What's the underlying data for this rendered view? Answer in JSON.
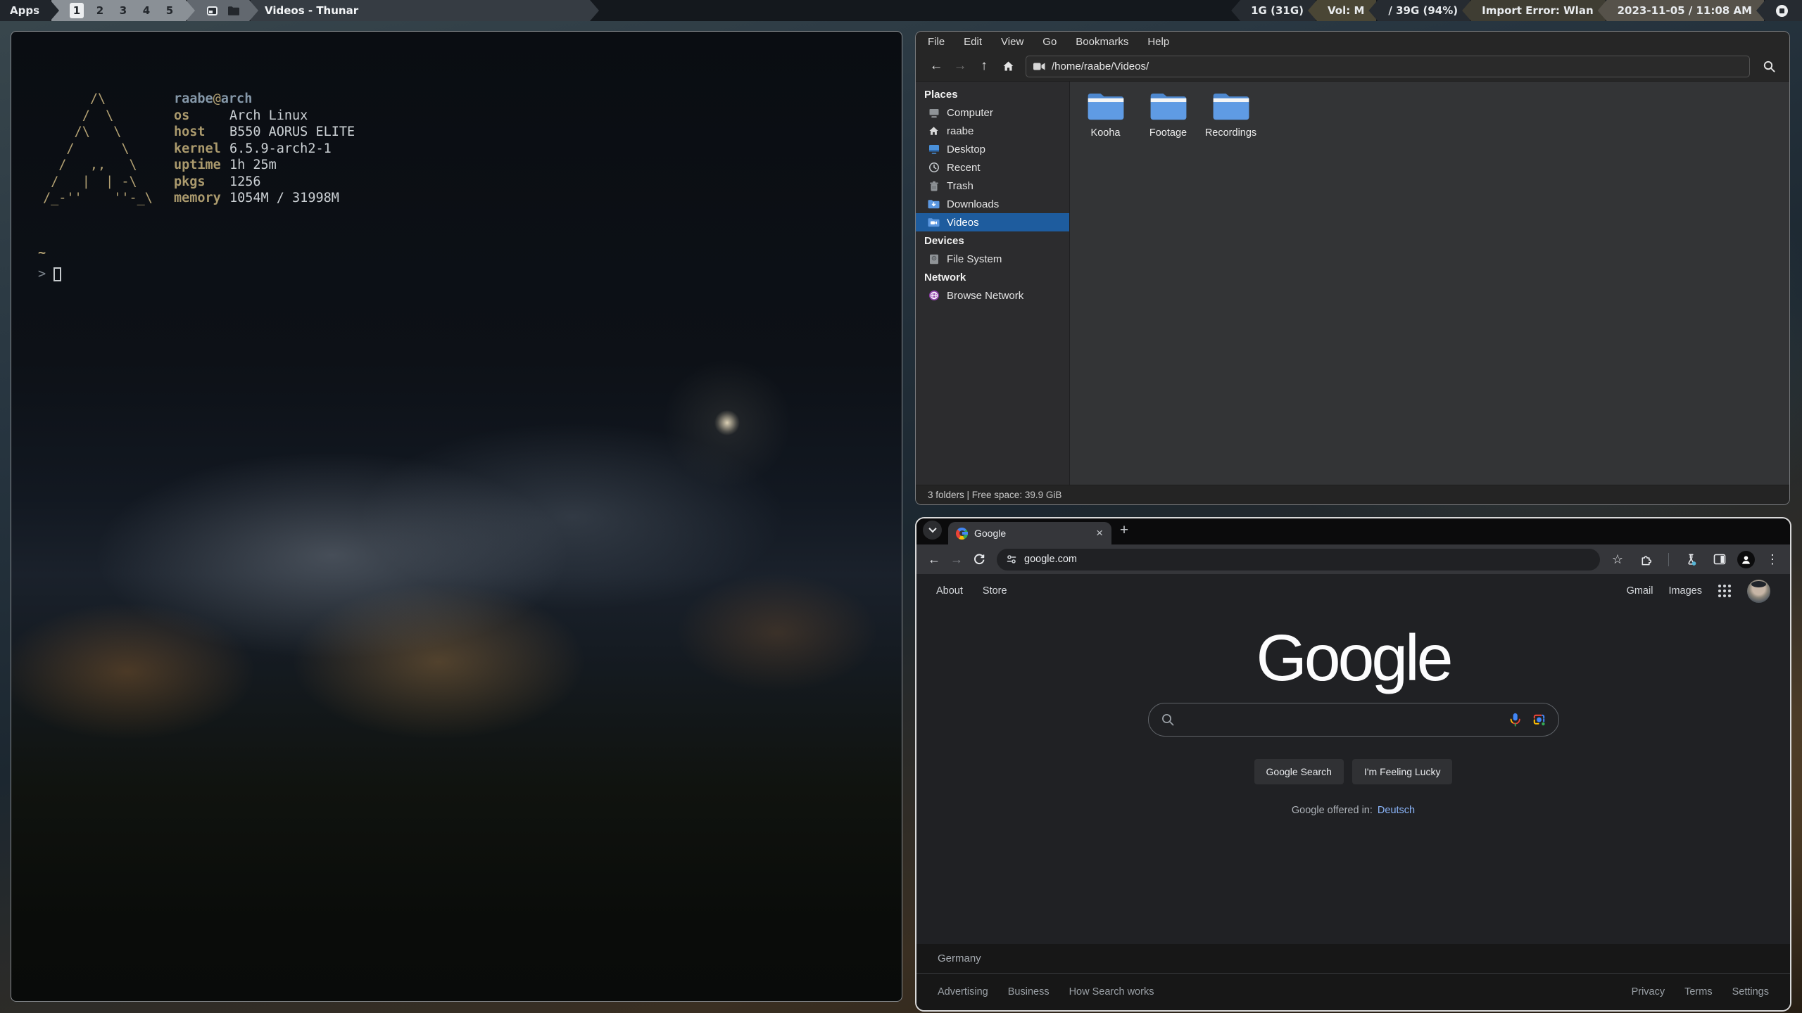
{
  "panel": {
    "apps_label": "Apps",
    "workspaces": [
      "1",
      "2",
      "3",
      "4",
      "5"
    ],
    "active_workspace": "1",
    "window_title": "Videos - Thunar",
    "status": [
      {
        "label": "1G (31G)"
      },
      {
        "label": "Vol: M"
      },
      {
        "label": "/ 39G (94%)"
      },
      {
        "label": "Import Error: Wlan"
      },
      {
        "label": "2023-11-05 / 11:08 AM"
      }
    ]
  },
  "terminal": {
    "ascii_logo": "      /\\\n     /  \\\n    /\\   \\\n   /      \\\n  /   ,,   \\\n /   |  | -\\\n/_-''    ''-_\\",
    "user": "raabe",
    "at": "@",
    "hostname": "arch",
    "info": [
      {
        "label": "os",
        "value": "Arch Linux"
      },
      {
        "label": "host",
        "value": "B550 AORUS ELITE"
      },
      {
        "label": "kernel",
        "value": "6.5.9-arch2-1"
      },
      {
        "label": "uptime",
        "value": "1h 25m"
      },
      {
        "label": "pkgs",
        "value": "1256"
      },
      {
        "label": "memory",
        "value": "1054M / 31998M"
      }
    ],
    "cwd": "~",
    "prompt": ">"
  },
  "thunar": {
    "menus": [
      "File",
      "Edit",
      "View",
      "Go",
      "Bookmarks",
      "Help"
    ],
    "path": "/home/raabe/Videos/",
    "sidebar": {
      "sections": [
        {
          "header": "Places",
          "items": [
            {
              "label": "Computer"
            },
            {
              "label": "raabe"
            },
            {
              "label": "Desktop"
            },
            {
              "label": "Recent"
            },
            {
              "label": "Trash"
            },
            {
              "label": "Downloads"
            },
            {
              "label": "Videos"
            }
          ]
        },
        {
          "header": "Devices",
          "items": [
            {
              "label": "File System"
            }
          ]
        },
        {
          "header": "Network",
          "items": [
            {
              "label": "Browse Network"
            }
          ]
        }
      ]
    },
    "folders": [
      "Kooha",
      "Footage",
      "Recordings"
    ],
    "statusbar": "3 folders  |  Free space: 39.9 GiB"
  },
  "chrome": {
    "tab_title": "Google",
    "url": "google.com",
    "page": {
      "about": "About",
      "store": "Store",
      "gmail": "Gmail",
      "images": "Images",
      "logo": "Google",
      "search_value": "",
      "btn_search": "Google Search",
      "btn_lucky": "I'm Feeling Lucky",
      "offered_in": "Google offered in:",
      "offered_lang": "Deutsch",
      "country": "Germany",
      "footer_left": [
        "Advertising",
        "Business",
        "How Search works"
      ],
      "footer_right": [
        "Privacy",
        "Terms",
        "Settings"
      ]
    }
  },
  "glyphs": {
    "back": "←",
    "forward": "→",
    "up": "↑",
    "close": "×",
    "new_tab": "+",
    "kebab": "⋮",
    "star": "☆"
  },
  "colors": {
    "accent_selection": "#1e5c9e",
    "google_blue": "#4285f4",
    "google_red": "#ea4335",
    "google_yellow": "#fbbc05",
    "google_green": "#34a853",
    "link_blue": "#8ab4f8",
    "panel_olive": "#4a4635"
  }
}
